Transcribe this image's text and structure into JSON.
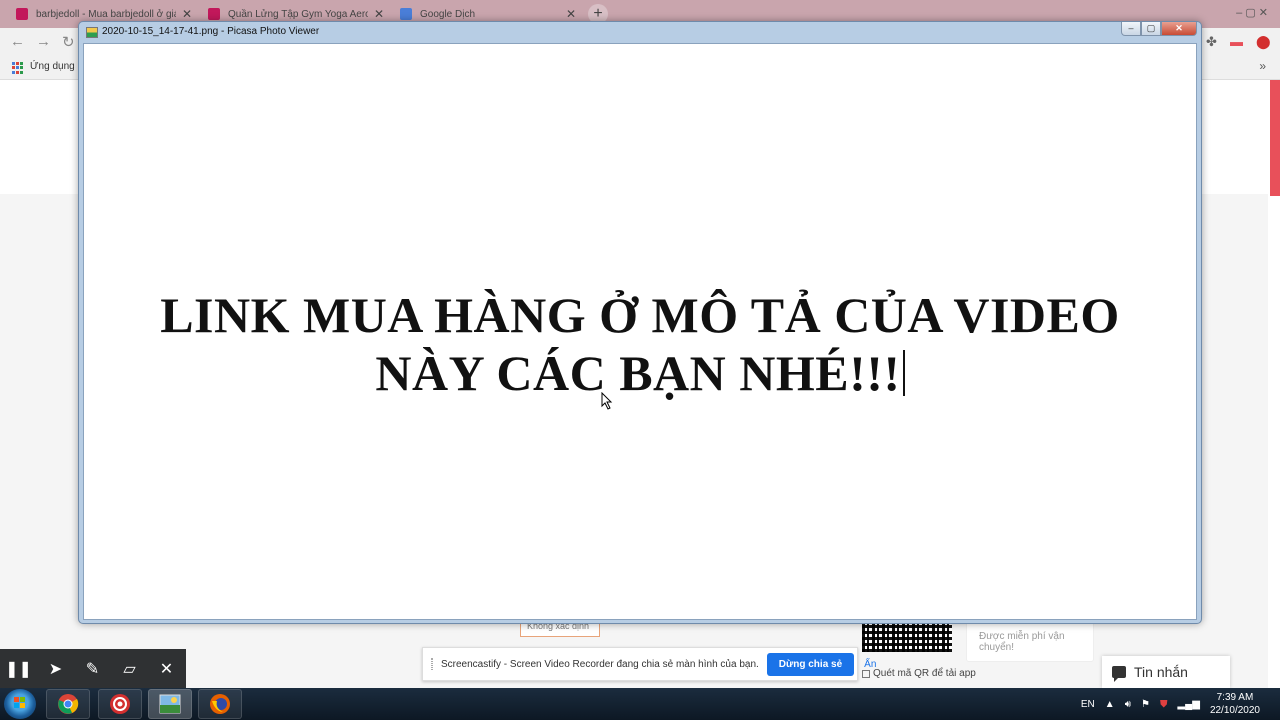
{
  "browser": {
    "tabs": [
      {
        "title": "barbjedoll - Mua barbjedoll ở giá",
        "favicon_color": "#c2185b",
        "active": false
      },
      {
        "title": "Quần Lửng Tập Gym Yoga Aerob",
        "favicon_color": "#c2185b",
        "active": false
      },
      {
        "title": "Google Dịch",
        "favicon_color": "#4a7ed8",
        "active": false
      }
    ],
    "new_tab": "+",
    "bookmarks_label": "Ứng dụng",
    "bookmarks_more": "»"
  },
  "picasa": {
    "title": "2020-10-15_14-17-41.png - Picasa Photo Viewer",
    "minimize": "‒",
    "restore": "▢",
    "close": "✕",
    "line1": "LINK MUA HÀNG Ở MÔ TẢ CỦA VIDEO",
    "line2": "NÀY CÁC BẠN NHÉ!!!"
  },
  "page": {
    "unknown_field": "Không xác định",
    "shipping_text": "Được miễn phí vận chuyển!",
    "qr_label": "Quét mã QR để tải app",
    "chat_label": "Tin nhắn",
    "accent": "#e8505a"
  },
  "screencastify": {
    "message": "Screencastify - Screen Video Recorder đang chia sẻ màn hình của bạn.",
    "stop_label": "Dừng chia sẻ",
    "hide_label": "Ẩn",
    "tools": [
      "pause-icon",
      "pointer-icon",
      "pen-icon",
      "eraser-icon",
      "close-icon"
    ]
  },
  "taskbar": {
    "apps": [
      "chrome-icon",
      "recorder-icon",
      "picasa-icon",
      "firefox-icon"
    ],
    "lang": "EN",
    "time": "7:39 AM",
    "date": "22/10/2020"
  }
}
